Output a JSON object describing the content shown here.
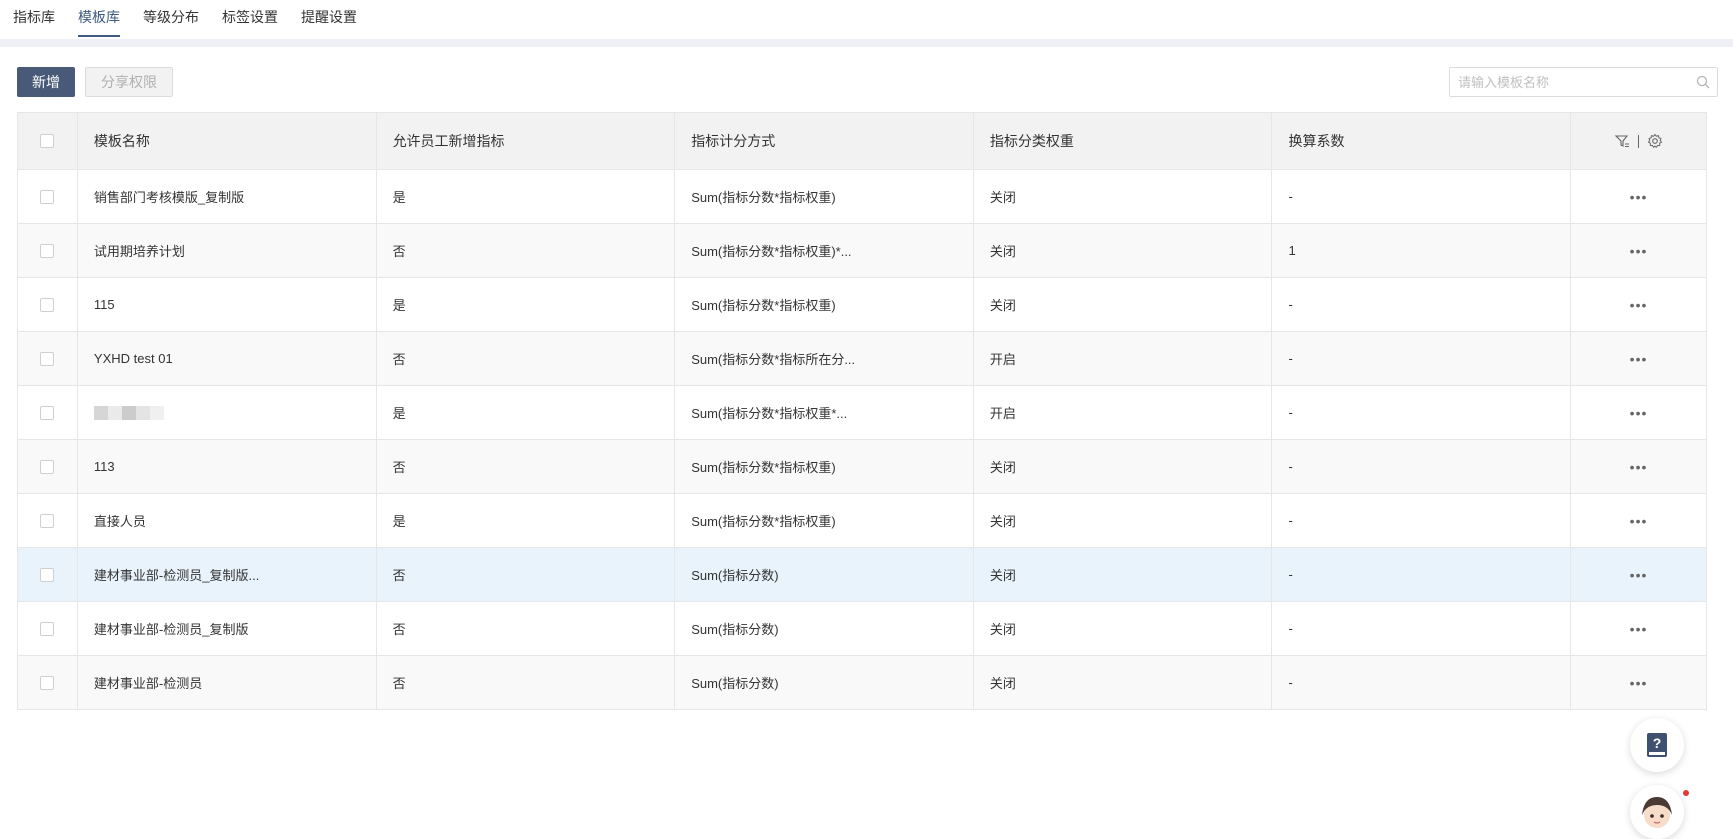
{
  "tabs": [
    "指标库",
    "模板库",
    "等级分布",
    "标签设置",
    "提醒设置"
  ],
  "active_tab_index": 1,
  "toolbar": {
    "add_label": "新增",
    "share_label": "分享权限"
  },
  "search": {
    "placeholder": "请输入模板名称",
    "value": ""
  },
  "table": {
    "headers": [
      "模板名称",
      "允许员工新增指标",
      "指标计分方式",
      "指标分类权重",
      "换算系数"
    ],
    "rows": [
      {
        "name": "销售部门考核模版_复制版",
        "allow": "是",
        "method": "Sum(指标分数*指标权重)",
        "weight": "关闭",
        "coef": "-"
      },
      {
        "name": "试用期培养计划",
        "allow": "否",
        "method": "Sum(指标分数*指标权重)*...",
        "weight": "关闭",
        "coef": "1"
      },
      {
        "name": "115",
        "allow": "是",
        "method": "Sum(指标分数*指标权重)",
        "weight": "关闭",
        "coef": "-"
      },
      {
        "name": "YXHD test 01",
        "allow": "否",
        "method": "Sum(指标分数*指标所在分...",
        "weight": "开启",
        "coef": "-"
      },
      {
        "name": "",
        "allow": "是",
        "method": "Sum(指标分数*指标权重*...",
        "weight": "开启",
        "coef": "-"
      },
      {
        "name": "113",
        "allow": "否",
        "method": "Sum(指标分数*指标权重)",
        "weight": "关闭",
        "coef": "-"
      },
      {
        "name": "直接人员",
        "allow": "是",
        "method": "Sum(指标分数*指标权重)",
        "weight": "关闭",
        "coef": "-"
      },
      {
        "name": "建材事业部-检测员_复制版...",
        "allow": "否",
        "method": "Sum(指标分数)",
        "weight": "关闭",
        "coef": "-"
      },
      {
        "name": "建材事业部-检测员_复制版",
        "allow": "否",
        "method": "Sum(指标分数)",
        "weight": "关闭",
        "coef": "-"
      },
      {
        "name": "建材事业部-检测员",
        "allow": "否",
        "method": "Sum(指标分数)",
        "weight": "关闭",
        "coef": "-"
      }
    ],
    "highlighted_row_index": 7,
    "row_action": "•••"
  },
  "icons": {
    "search": "search-icon",
    "filter": "filter-icon",
    "settings": "gear-icon",
    "help": "help-book-icon",
    "assistant": "assistant-avatar"
  },
  "colors": {
    "primary": "#485a78",
    "active_tab": "#3d5a80",
    "highlight_row": "#e8f3fc",
    "badge": "#e53935"
  }
}
